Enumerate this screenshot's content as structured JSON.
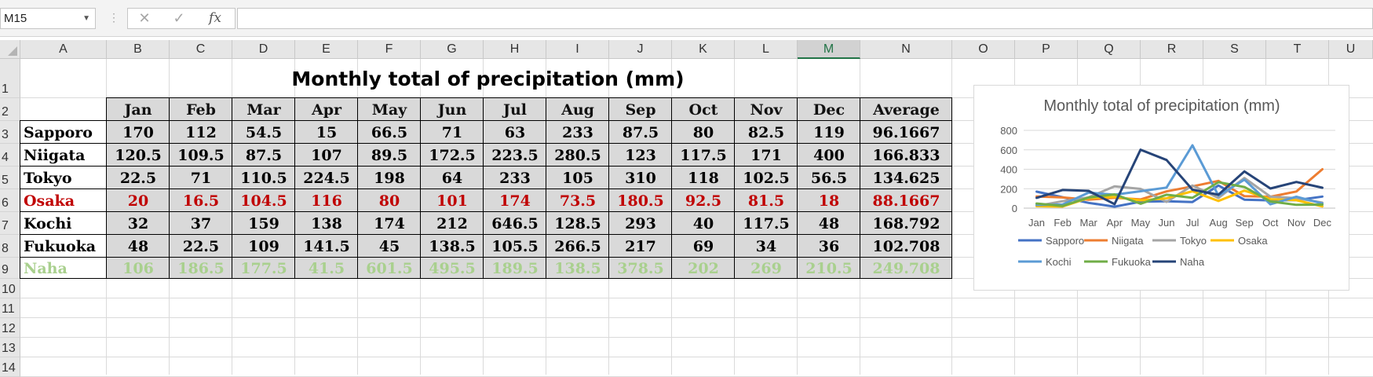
{
  "formula_bar": {
    "name_box": "M15",
    "cancel_icon": "✕",
    "enter_icon": "✓",
    "function_icon": "fx",
    "formula": ""
  },
  "columns": [
    "A",
    "B",
    "C",
    "D",
    "E",
    "F",
    "G",
    "H",
    "I",
    "J",
    "K",
    "L",
    "M",
    "N",
    "O",
    "P",
    "Q",
    "R",
    "S",
    "T",
    "U"
  ],
  "selected_column": "M",
  "rows": [
    "1",
    "2",
    "3",
    "4",
    "5",
    "6",
    "7",
    "8",
    "9",
    "10",
    "11",
    "12",
    "13",
    "14"
  ],
  "sheet": {
    "title": "Monthly total of precipitation (mm)",
    "headers": [
      "Jan",
      "Feb",
      "Mar",
      "Apr",
      "May",
      "Jun",
      "Jul",
      "Aug",
      "Sep",
      "Oct",
      "Nov",
      "Dec",
      "Average"
    ],
    "cities": [
      {
        "name": "Sapporo",
        "color": "#000000",
        "values": [
          "170",
          "112",
          "54.5",
          "15",
          "66.5",
          "71",
          "63",
          "233",
          "87.5",
          "80",
          "82.5",
          "119",
          "96.1667"
        ]
      },
      {
        "name": "Niigata",
        "color": "#000000",
        "values": [
          "120.5",
          "109.5",
          "87.5",
          "107",
          "89.5",
          "172.5",
          "223.5",
          "280.5",
          "123",
          "117.5",
          "171",
          "400",
          "166.833"
        ]
      },
      {
        "name": "Tokyo",
        "color": "#000000",
        "values": [
          "22.5",
          "71",
          "110.5",
          "224.5",
          "198",
          "64",
          "233",
          "105",
          "310",
          "118",
          "102.5",
          "56.5",
          "134.625"
        ]
      },
      {
        "name": "Osaka",
        "color": "#c00000",
        "values": [
          "20",
          "16.5",
          "104.5",
          "116",
          "80",
          "101",
          "174",
          "73.5",
          "180.5",
          "92.5",
          "81.5",
          "18",
          "88.1667"
        ]
      },
      {
        "name": "Kochi",
        "color": "#000000",
        "values": [
          "32",
          "37",
          "159",
          "138",
          "174",
          "212",
          "646.5",
          "128.5",
          "293",
          "40",
          "117.5",
          "48",
          "168.792"
        ]
      },
      {
        "name": "Fukuoka",
        "color": "#000000",
        "values": [
          "48",
          "22.5",
          "109",
          "141.5",
          "45",
          "138.5",
          "105.5",
          "266.5",
          "217",
          "69",
          "34",
          "36",
          "102.708"
        ]
      },
      {
        "name": "Naha",
        "color": "#a9d08e",
        "values": [
          "106",
          "186.5",
          "177.5",
          "41.5",
          "601.5",
          "495.5",
          "189.5",
          "138.5",
          "378.5",
          "202",
          "269",
          "210.5",
          "249.708"
        ]
      }
    ]
  },
  "chart_data": {
    "type": "line",
    "title": "Monthly total of precipitation (mm)",
    "categories": [
      "Jan",
      "Feb",
      "Mar",
      "Apr",
      "May",
      "Jun",
      "Jul",
      "Aug",
      "Sep",
      "Oct",
      "Nov",
      "Dec"
    ],
    "ylim": [
      0,
      800
    ],
    "yticks": [
      "0",
      "200",
      "400",
      "600",
      "800"
    ],
    "grid": true,
    "legend_position": "bottom",
    "series": [
      {
        "name": "Sapporo",
        "color": "#4472c4",
        "values": [
          170,
          112,
          54.5,
          15,
          66.5,
          71,
          63,
          233,
          87.5,
          80,
          82.5,
          119
        ]
      },
      {
        "name": "Niigata",
        "color": "#ed7d31",
        "values": [
          120.5,
          109.5,
          87.5,
          107,
          89.5,
          172.5,
          223.5,
          280.5,
          123,
          117.5,
          171,
          400
        ]
      },
      {
        "name": "Tokyo",
        "color": "#a5a5a5",
        "values": [
          22.5,
          71,
          110.5,
          224.5,
          198,
          64,
          233,
          105,
          310,
          118,
          102.5,
          56.5
        ]
      },
      {
        "name": "Osaka",
        "color": "#ffc000",
        "values": [
          20,
          16.5,
          104.5,
          116,
          80,
          101,
          174,
          73.5,
          180.5,
          92.5,
          81.5,
          18
        ]
      },
      {
        "name": "Kochi",
        "color": "#5b9bd5",
        "values": [
          32,
          37,
          159,
          138,
          174,
          212,
          646.5,
          128.5,
          293,
          40,
          117.5,
          48
        ]
      },
      {
        "name": "Fukuoka",
        "color": "#70ad47",
        "values": [
          48,
          22.5,
          109,
          141.5,
          45,
          138.5,
          105.5,
          266.5,
          217,
          69,
          34,
          36
        ]
      },
      {
        "name": "Naha",
        "color": "#264478",
        "values": [
          106,
          186.5,
          177.5,
          41.5,
          601.5,
          495.5,
          189.5,
          138.5,
          378.5,
          202,
          269,
          210.5
        ]
      }
    ]
  }
}
